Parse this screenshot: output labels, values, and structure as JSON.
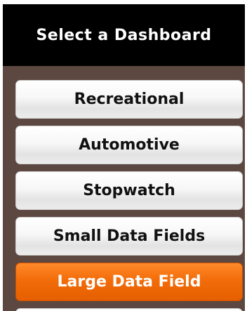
{
  "header": {
    "title": "Select a Dashboard"
  },
  "menu": {
    "items": [
      {
        "label": "Recreational",
        "selected": false
      },
      {
        "label": "Automotive",
        "selected": false
      },
      {
        "label": "Stopwatch",
        "selected": false
      },
      {
        "label": "Small Data Fields",
        "selected": false
      },
      {
        "label": "Large Data Field",
        "selected": true
      }
    ]
  },
  "colors": {
    "screen_background": "#5c4840",
    "title_background": "#000000",
    "selected_accent": "#f36c0a",
    "item_background": "#f2f2f2"
  }
}
